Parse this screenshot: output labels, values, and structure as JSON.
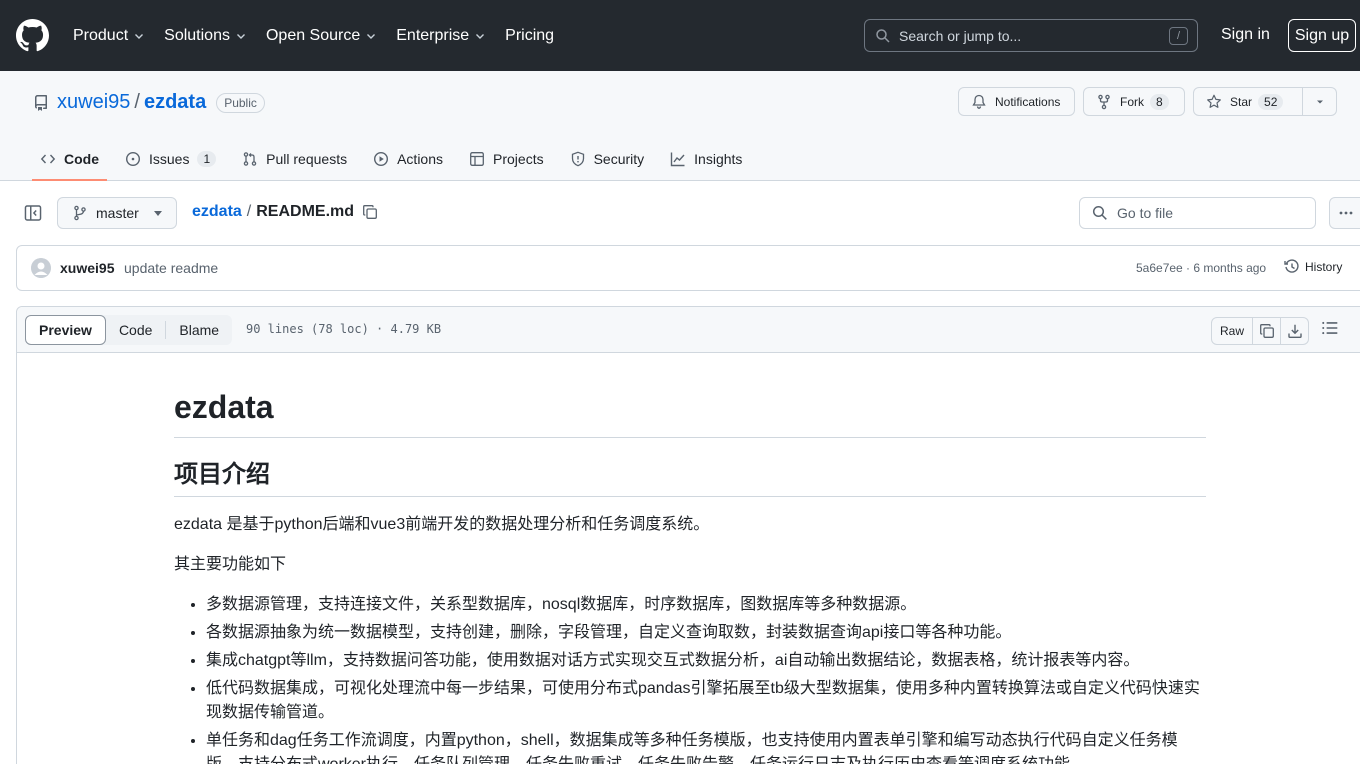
{
  "header": {
    "nav": [
      {
        "label": "Product",
        "dropdown": true
      },
      {
        "label": "Solutions",
        "dropdown": true
      },
      {
        "label": "Open Source",
        "dropdown": true
      },
      {
        "label": "Enterprise",
        "dropdown": true
      },
      {
        "label": "Pricing",
        "dropdown": false
      }
    ],
    "search_placeholder": "Search or jump to...",
    "search_shortcut": "/",
    "signin": "Sign in",
    "signup": "Sign up"
  },
  "repo": {
    "owner": "xuwei95",
    "sep": "/",
    "name": "ezdata",
    "visibility": "Public",
    "notifications_label": "Notifications",
    "fork_label": "Fork",
    "fork_count": "8",
    "star_label": "Star",
    "star_count": "52",
    "tabs": [
      {
        "label": "Code",
        "icon": "code-icon",
        "active": true
      },
      {
        "label": "Issues",
        "icon": "issue-icon",
        "count": "1"
      },
      {
        "label": "Pull requests",
        "icon": "pull-request-icon"
      },
      {
        "label": "Actions",
        "icon": "play-icon"
      },
      {
        "label": "Projects",
        "icon": "table-icon"
      },
      {
        "label": "Security",
        "icon": "shield-icon"
      },
      {
        "label": "Insights",
        "icon": "graph-icon"
      }
    ]
  },
  "file_nav": {
    "branch": "master",
    "path_repo": "ezdata",
    "path_sep": "/",
    "path_file": "README.md",
    "goto_placeholder": "Go to file"
  },
  "commit": {
    "author": "xuwei95",
    "message": "update readme",
    "meta": "5a6e7ee · 6 months ago",
    "history": "History"
  },
  "viewer": {
    "tabs": [
      "Preview",
      "Code",
      "Blame"
    ],
    "info": "90 lines (78 loc) · 4.79 KB",
    "raw": "Raw"
  },
  "readme": {
    "h1": "ezdata",
    "h2": "项目介绍",
    "intro": "ezdata 是基于python后端和vue3前端开发的数据处理分析和任务调度系统。",
    "features_title": "其主要功能如下",
    "features": [
      "多数据源管理，支持连接文件，关系型数据库，nosql数据库，时序数据库，图数据库等多种数据源。",
      "各数据源抽象为统一数据模型，支持创建，删除，字段管理，自定义查询取数，封装数据查询api接口等各种功能。",
      "集成chatgpt等llm，支持数据问答功能，使用数据对话方式实现交互式数据分析，ai自动输出数据结论，数据表格，统计报表等内容。",
      "低代码数据集成，可视化处理流中每一步结果，可使用分布式pandas引擎拓展至tb级大型数据集，使用多种内置转换算法或自定义代码快速实现数据传输管道。",
      "单任务和dag任务工作流调度，内置python，shell，数据集成等多种任务模版，也支持使用内置表单引擎和编写动态执行代码自定义任务模版，支持分布式worker执行，任务队列管理，任务失败重试，任务失败告警，任务运行日志及执行历史查看等调度系统功能。"
    ]
  },
  "colors": {
    "header_bg": "#24292f",
    "link": "#0969da",
    "tab_underline": "#fd8c73",
    "muted": "#59636e",
    "border": "#d0d7de"
  }
}
